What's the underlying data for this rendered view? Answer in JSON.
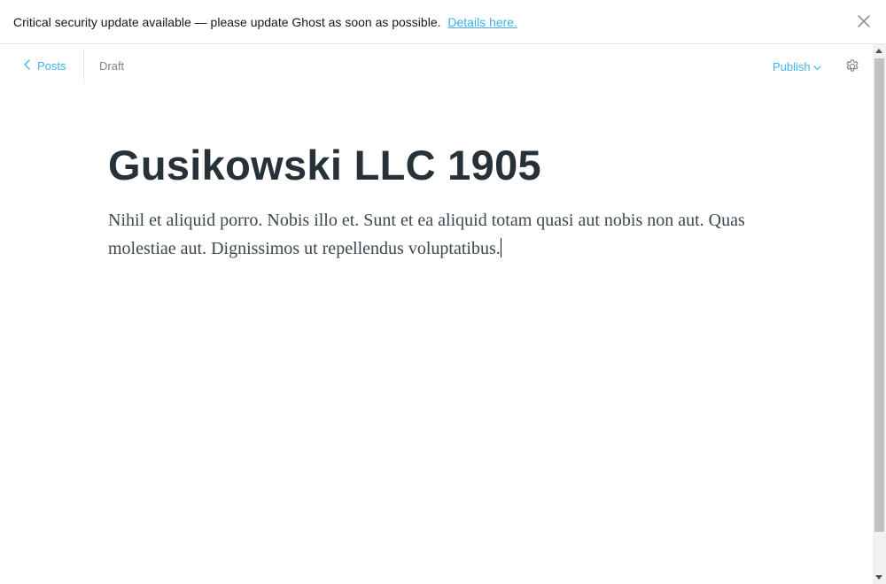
{
  "alert": {
    "message": "Critical security update available — please update Ghost as soon as possible.",
    "link_text": "Details here."
  },
  "editor": {
    "back_label": "Posts",
    "status": "Draft",
    "publish_label": "Publish"
  },
  "post": {
    "title": "Gusikowski LLC 1905",
    "body": "Nihil et aliquid porro. Nobis illo et. Sunt et ea aliquid totam quasi aut nobis non aut. Quas molestiae aut. Dignissimos ut repellendus voluptatibus."
  },
  "colors": {
    "accent": "#3eb0ef",
    "title": "#263238",
    "body": "#3c484e"
  }
}
